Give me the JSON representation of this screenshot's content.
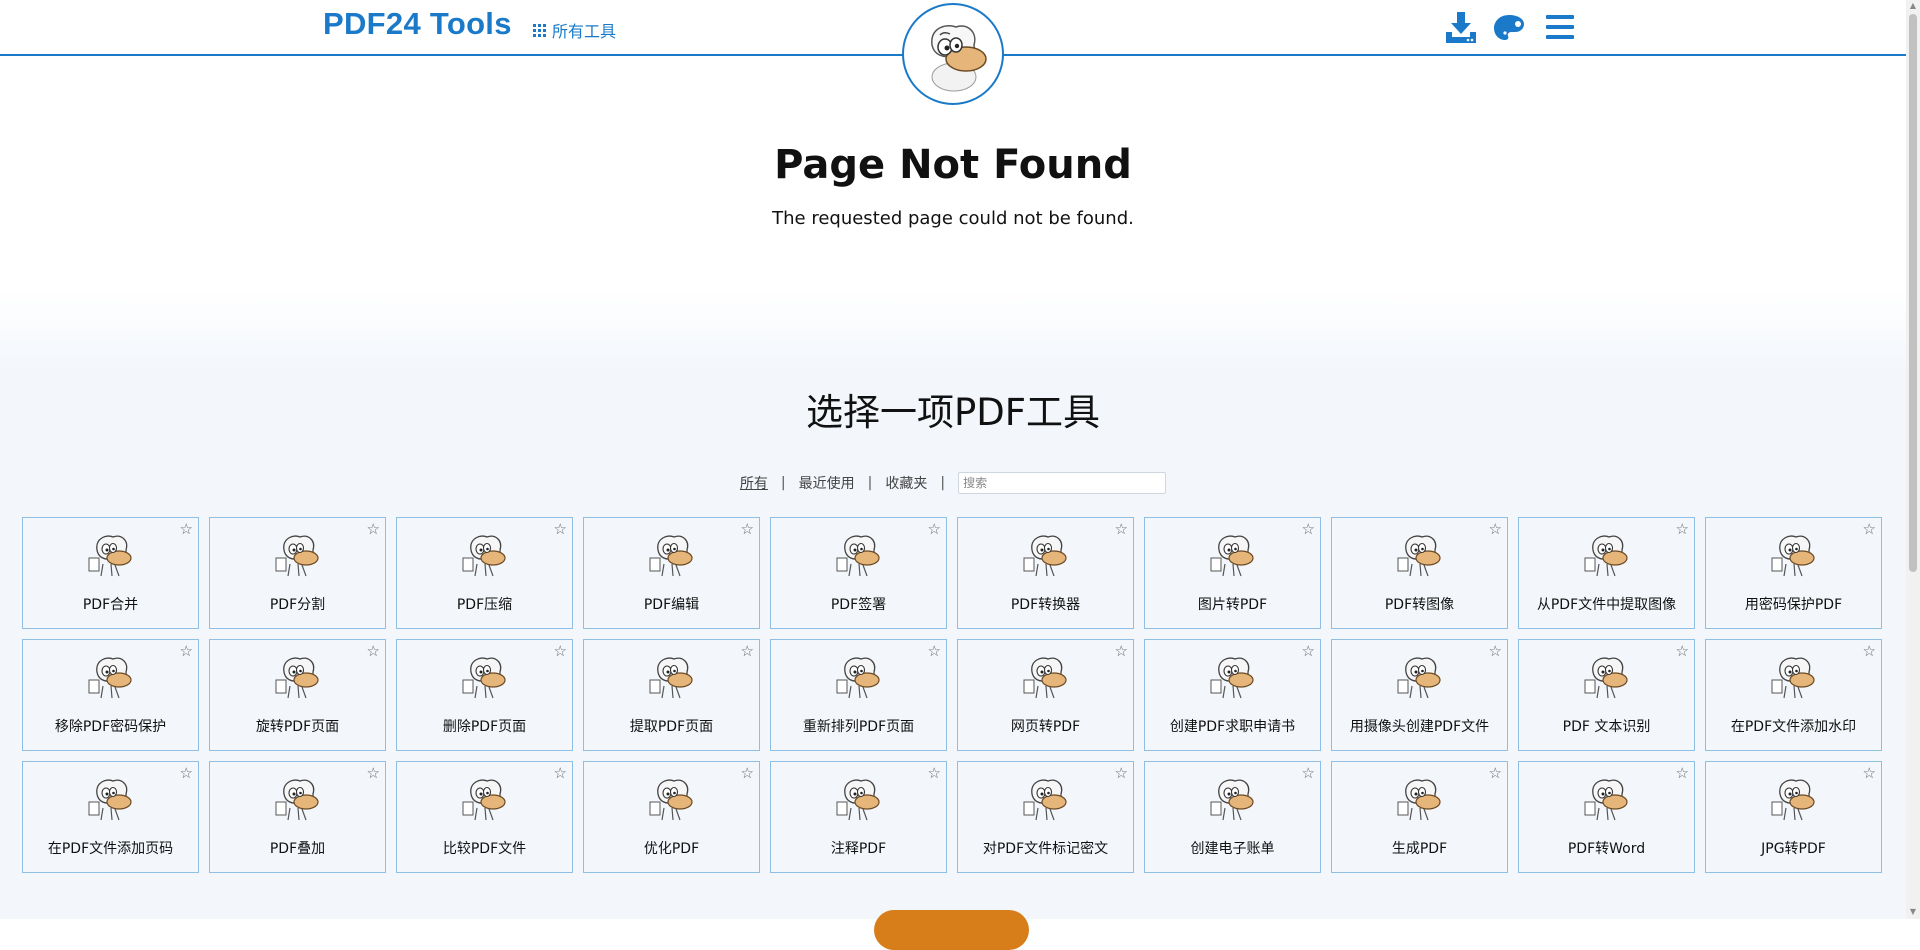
{
  "header": {
    "logo_text": "PDF24 Tools",
    "all_tools_label": "所有工具",
    "icons": [
      "download-icon",
      "palette-icon",
      "menu-icon"
    ],
    "accent_color": "#1a7ac9"
  },
  "not_found": {
    "title": "Page Not Found",
    "message": "The requested page could not be found."
  },
  "tools": {
    "title": "选择一项PDF工具",
    "filters": {
      "all": "所有",
      "recent": "最近使用",
      "favorites": "收藏夹"
    },
    "search_placeholder": "搜索",
    "items": [
      {
        "label": "PDF合并",
        "icon": "merge-pdf-icon"
      },
      {
        "label": "PDF分割",
        "icon": "split-pdf-icon"
      },
      {
        "label": "PDF压缩",
        "icon": "compress-pdf-icon"
      },
      {
        "label": "PDF编辑",
        "icon": "edit-pdf-icon"
      },
      {
        "label": "PDF签署",
        "icon": "sign-pdf-icon"
      },
      {
        "label": "PDF转换器",
        "icon": "pdf-converter-icon"
      },
      {
        "label": "图片转PDF",
        "icon": "image-to-pdf-icon"
      },
      {
        "label": "PDF转图像",
        "icon": "pdf-to-image-icon"
      },
      {
        "label": "从PDF文件中提取图像",
        "icon": "extract-images-icon"
      },
      {
        "label": "用密码保护PDF",
        "icon": "protect-pdf-icon"
      },
      {
        "label": "移除PDF密码保护",
        "icon": "unlock-pdf-icon"
      },
      {
        "label": "旋转PDF页面",
        "icon": "rotate-pdf-icon"
      },
      {
        "label": "删除PDF页面",
        "icon": "delete-pages-icon"
      },
      {
        "label": "提取PDF页面",
        "icon": "extract-pages-icon"
      },
      {
        "label": "重新排列PDF页面",
        "icon": "reorder-pages-icon"
      },
      {
        "label": "网页转PDF",
        "icon": "webpage-to-pdf-icon"
      },
      {
        "label": "创建PDF求职申请书",
        "icon": "job-application-icon"
      },
      {
        "label": "用摄像头创建PDF文件",
        "icon": "webcam-pdf-icon"
      },
      {
        "label": "PDF 文本识别",
        "icon": "ocr-pdf-icon"
      },
      {
        "label": "在PDF文件添加水印",
        "icon": "watermark-pdf-icon"
      },
      {
        "label": "在PDF文件添加页码",
        "icon": "page-numbers-icon"
      },
      {
        "label": "PDF叠加",
        "icon": "overlay-pdf-icon"
      },
      {
        "label": "比较PDF文件",
        "icon": "compare-pdf-icon"
      },
      {
        "label": "优化PDF",
        "icon": "optimize-pdf-icon"
      },
      {
        "label": "注释PDF",
        "icon": "annotate-pdf-icon"
      },
      {
        "label": "对PDF文件标记密文",
        "icon": "redact-pdf-icon"
      },
      {
        "label": "创建电子账单",
        "icon": "e-invoice-icon"
      },
      {
        "label": "生成PDF",
        "icon": "create-pdf-icon"
      },
      {
        "label": "PDF转Word",
        "icon": "pdf-to-word-icon"
      },
      {
        "label": "JPG转PDF",
        "icon": "jpg-to-pdf-icon"
      }
    ]
  }
}
